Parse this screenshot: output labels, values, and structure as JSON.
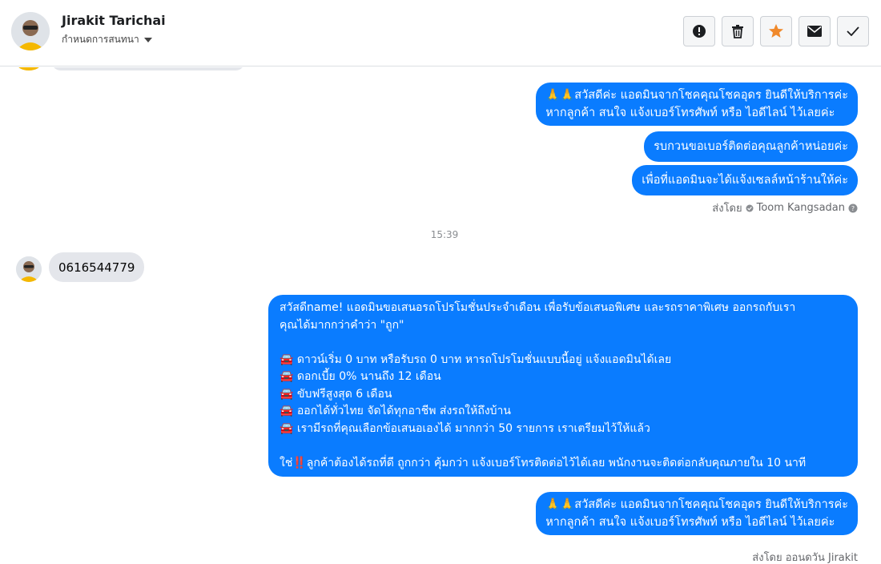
{
  "header": {
    "contact_name": "Jirakit Tarichai",
    "subtitle": "กำหนดการสนทนา",
    "actions": {
      "report": "!",
      "delete": "delete",
      "star": "star",
      "mail": "mail",
      "done": "done"
    }
  },
  "messages": {
    "outgoing_1": {
      "emoji": "🙏🙏",
      "line1": "สวัสดีค่ะ แอดมินจากโชคคุณโชคอุดร ยินดีให้บริการค่ะ",
      "line2": "หากลูกค้า สนใจ แจ้งเบอร์โทรศัพท์ หรือ ไอดีไลน์  ไว้เลยค่ะ"
    },
    "outgoing_2": "รบกวนขอเบอร์ติดต่อคุณลูกค้าหน่อยค่ะ",
    "outgoing_3": "เพื่อที่แอดมินจะได้แจ้งเซลล์หน้าร้านให้ค่ะ",
    "sent_by_label": "ส่งโดย",
    "sent_by_name": "Toom Kangsadan",
    "time_separator": "15:39",
    "incoming_1": "0616544779",
    "promo": {
      "intro_1": "สวัสดีname! แอดมินขอเสนอรถโปรโมชั่นประจำเดือน เพื่อรับข้อเสนอพิเศษ และรถราคาพิเศษ ออกรถกับเรา",
      "intro_2": "คุณได้มากกว่าคำว่า \"ถูก\"",
      "bullet_icon": "car-icon",
      "bullets": [
        "ดาวน์เริ่ม 0 บาท หรือรับรถ 0 บาท หารถโปรโมชั่นแบบนี้อยู่ แจ้งแอดมินได้เลย",
        "ดอกเบี้ย 0% นานถึง 12 เดือน",
        "ขับฟรีสูงสุด 6 เดือน",
        "ออกได้ทั่วไทย จัดได้ทุกอาชีพ ส่งรถให้ถึงบ้าน",
        "เรามีรถที่คุณเลือกข้อเสนอเองได้ มากกว่า 50 รายการ เราเตรียมไว้ให้แล้ว"
      ],
      "closing_prefix": "ใช่",
      "closing_emoji": "‼️",
      "closing_text": "ลูกค้าต้องได้รถที่ดี ถูกกว่า คุ้มกว่า แจ้งเบอร์โทรติดต่อไว้ได้เลย พนักงานจะติดต่อกลับคุณภายใน 10 นาที"
    },
    "outgoing_4": {
      "emoji": "🙏🙏",
      "line1": "สวัสดีค่ะ แอดมินจากโชคคุณโชคอุดร ยินดีให้บริการค่ะ",
      "line2": "หากลูกค้า สนใจ แจ้งเบอร์โทรศัพท์ หรือ ไอดีไลน์  ไว้เลยค่ะ"
    },
    "footer_partial": "ส่งโดย ออนดวัน Jirakit"
  },
  "colors": {
    "bubble_out": "#0a7cff",
    "bubble_in": "#e4e6eb",
    "star": "#f0892b"
  }
}
